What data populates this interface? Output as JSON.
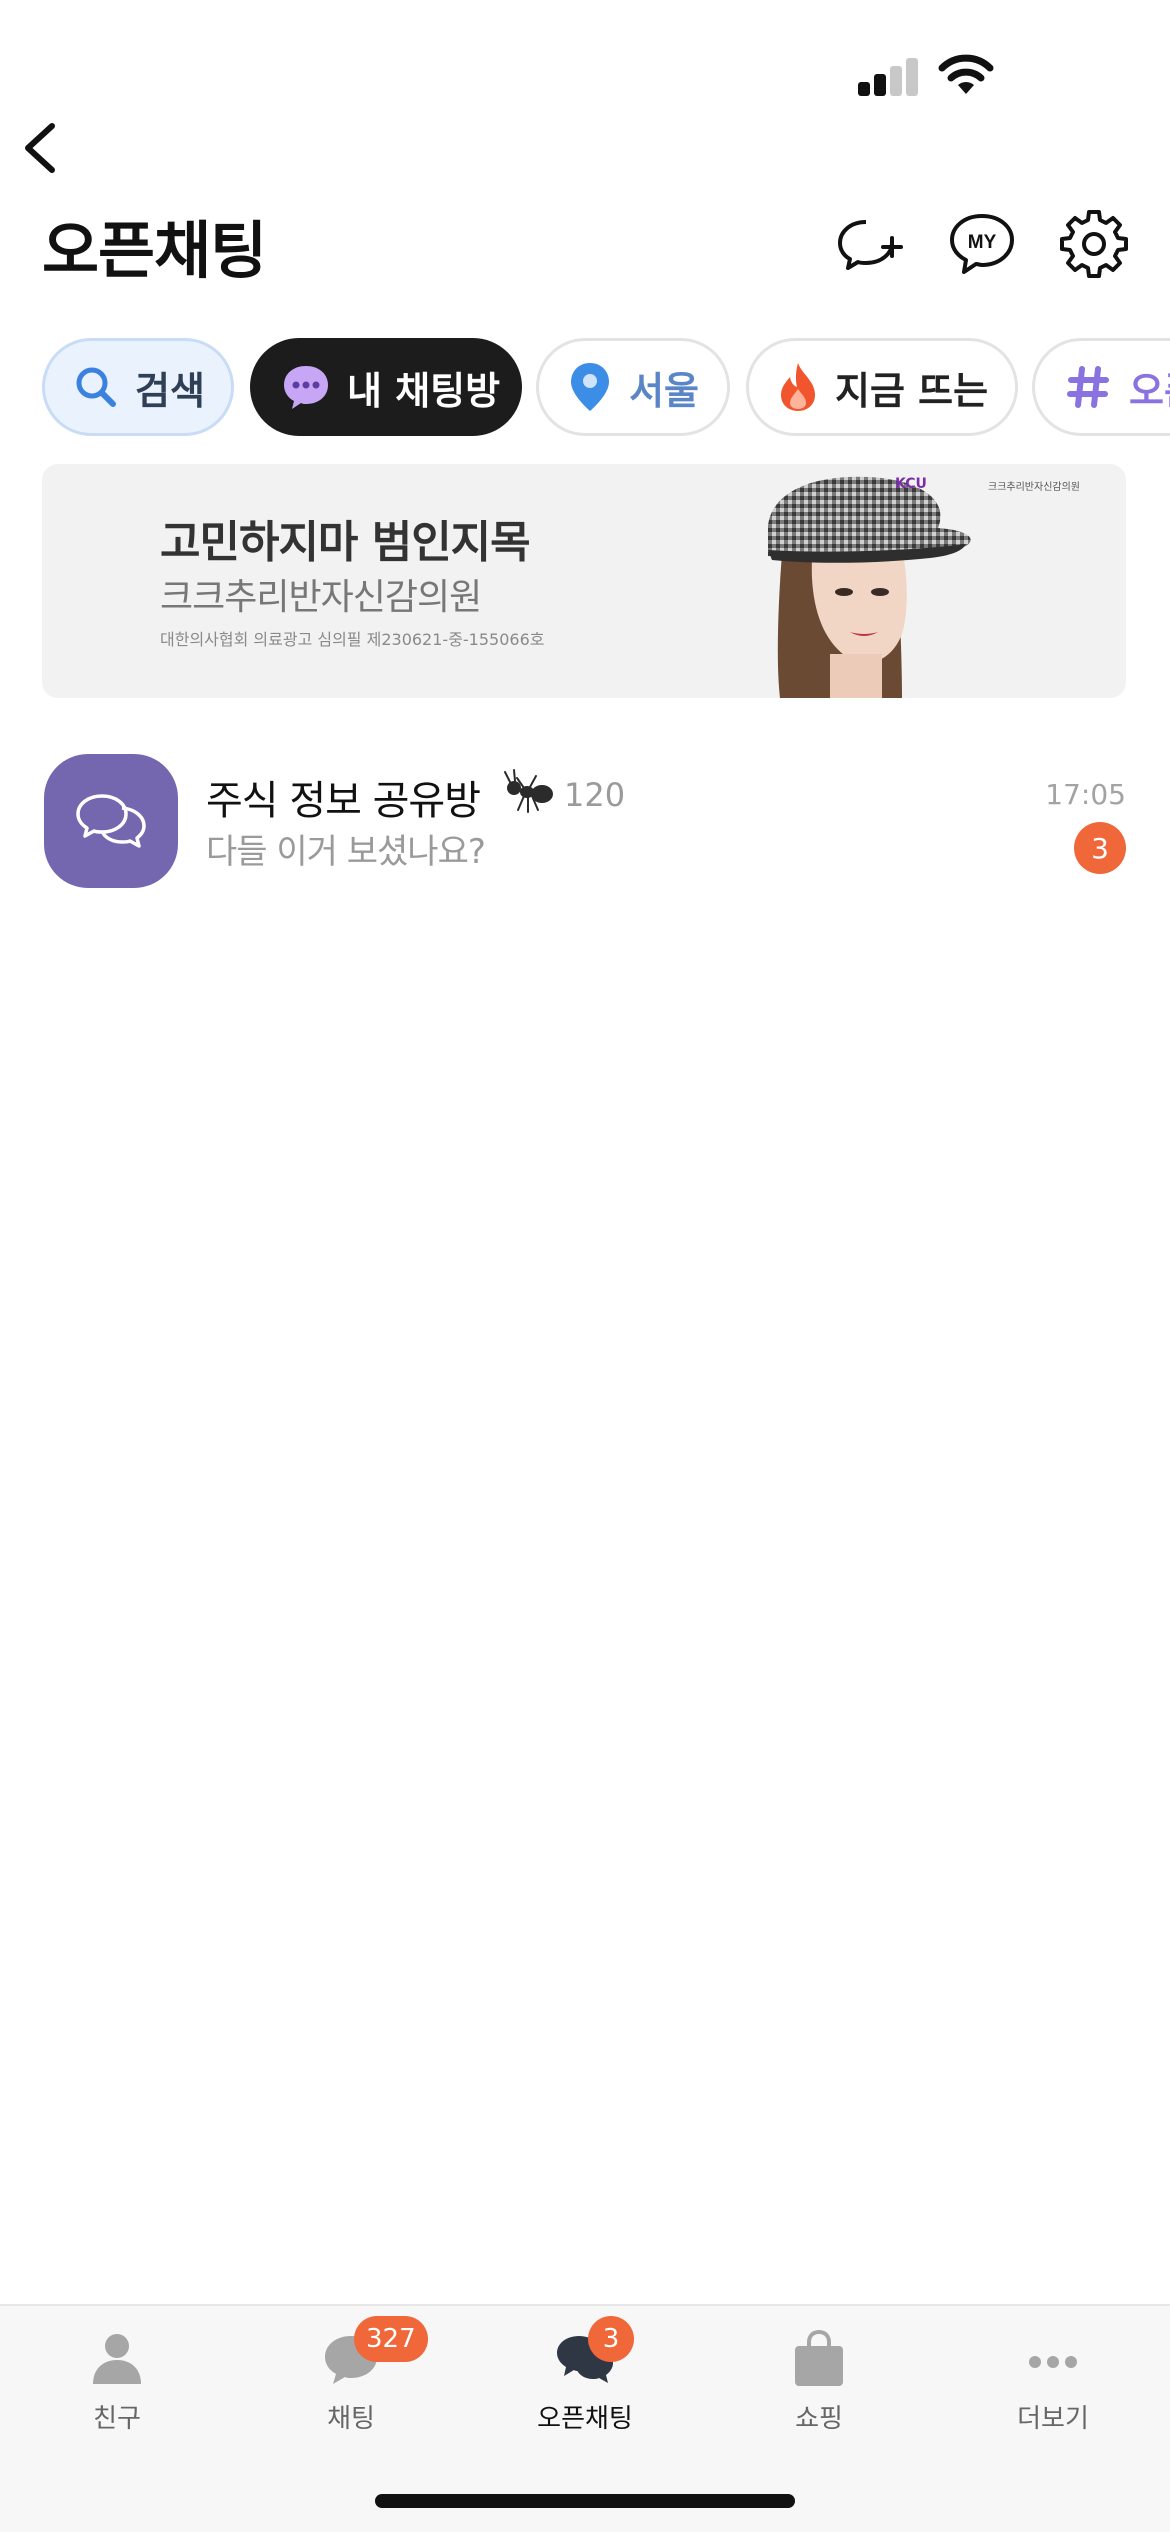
{
  "header": {
    "title": "오픈채팅"
  },
  "filters": [
    {
      "label": "검색",
      "icon": "search-icon",
      "color": "#3b82e0"
    },
    {
      "label": "내 채팅방",
      "icon": "chat-bubble-icon",
      "color": "#c7a6f5"
    },
    {
      "label": "서울",
      "icon": "location-pin-icon",
      "color": "#3b8de6"
    },
    {
      "label": "지금 뜨는",
      "icon": "flame-icon",
      "color": "#f0552e"
    },
    {
      "label": "오픈",
      "icon": "hashtag-icon",
      "color": "#8a73e0"
    }
  ],
  "ad": {
    "title": "고민하지마 범인지목",
    "subtitle": "크크추리반자신감의원",
    "note": "대한의사협회 의료광고 심의필 제230621-중-155066호",
    "logo_mark": "KCU",
    "logo_text": "크크추리반자신감의원"
  },
  "chats": [
    {
      "name": "주식 정보 공유방",
      "emoji": "ant-icon",
      "member_count": "120",
      "preview": "다들 이거 보셨나요?",
      "time": "17:05",
      "unread": "3",
      "avatar_color": "#7566b0"
    }
  ],
  "tabs": [
    {
      "label": "친구",
      "icon": "person-icon",
      "badge": ""
    },
    {
      "label": "채팅",
      "icon": "chat-icon",
      "badge": "327"
    },
    {
      "label": "오픈채팅",
      "icon": "open-chat-icon",
      "badge": "3"
    },
    {
      "label": "쇼핑",
      "icon": "shopping-bag-icon",
      "badge": ""
    },
    {
      "label": "더보기",
      "icon": "more-icon",
      "badge": ""
    }
  ],
  "colors": {
    "accent": "#f0673a",
    "dark": "#1c1c1c"
  }
}
